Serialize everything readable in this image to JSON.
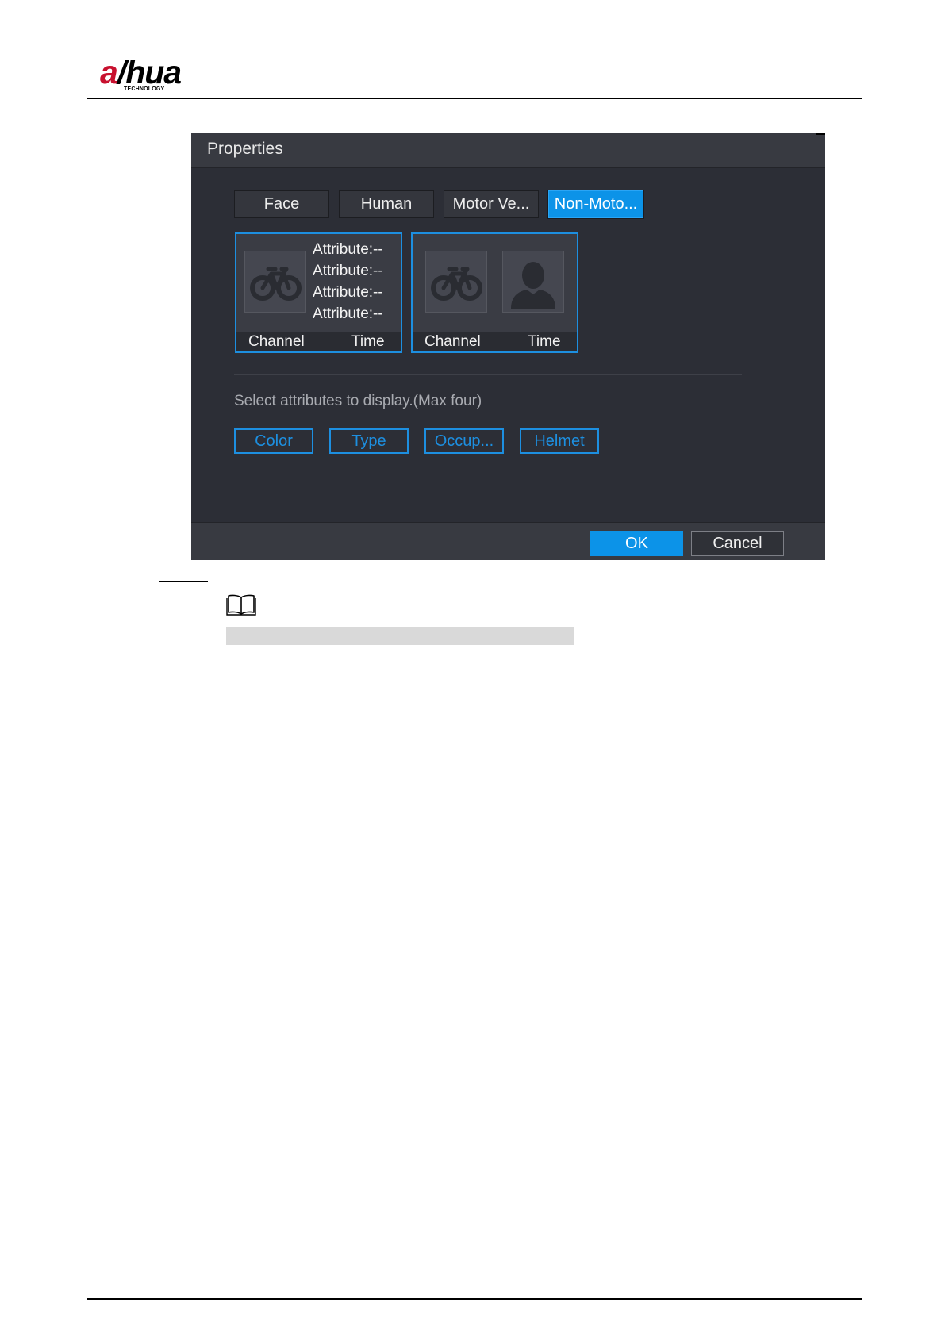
{
  "brand": {
    "logo_text": "alhua",
    "logo_sub": "TECHNOLOGY"
  },
  "dialog": {
    "title": "Properties",
    "tabs": [
      {
        "label": "Face",
        "active": false
      },
      {
        "label": "Human",
        "active": false
      },
      {
        "label": "Motor Ve...",
        "active": false
      },
      {
        "label": "Non-Moto...",
        "active": true
      }
    ],
    "preview_cards": [
      {
        "thumbnails": [
          "bicycle-icon"
        ],
        "attributes": [
          "Attribute:--",
          "Attribute:--",
          "Attribute:--",
          "Attribute:--"
        ],
        "channel_label": "Channel",
        "time_label": "Time"
      },
      {
        "thumbnails": [
          "bicycle-icon",
          "person-icon"
        ],
        "channel_label": "Channel",
        "time_label": "Time"
      }
    ],
    "hint": "Select attributes to display.(Max four)",
    "attribute_buttons": [
      "Color",
      "Type",
      "Occup...",
      "Helmet"
    ],
    "ok_label": "OK",
    "cancel_label": "Cancel"
  },
  "colors": {
    "accent": "#0c93e8",
    "dialog_bg": "#2c2e36",
    "titlebar_bg": "#383a41",
    "logo_red": "#c8102e"
  },
  "note_icon": "book-icon"
}
